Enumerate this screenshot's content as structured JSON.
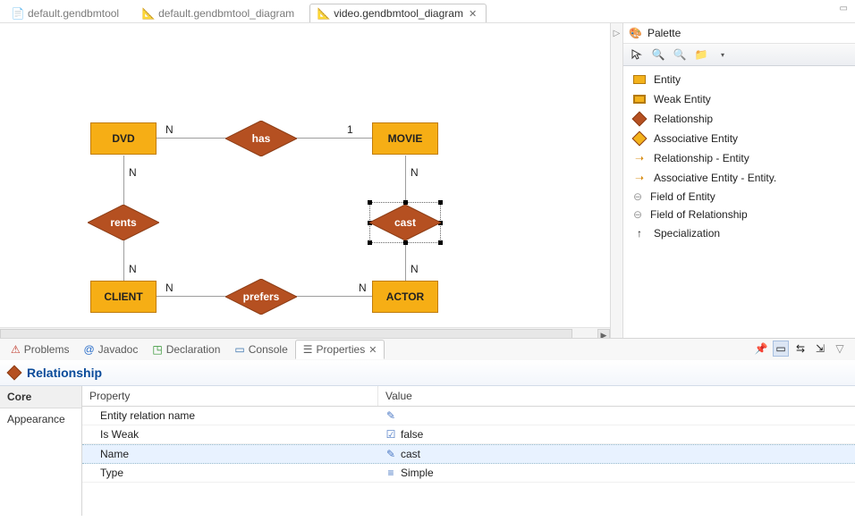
{
  "tabs": {
    "items": [
      {
        "label": "default.gendbmtool",
        "active": false
      },
      {
        "label": "default.gendbmtool_diagram",
        "active": false
      },
      {
        "label": "video.gendbmtool_diagram",
        "active": true
      }
    ]
  },
  "diagram": {
    "entities": {
      "dvd": "DVD",
      "movie": "MOVIE",
      "client": "CLIENT",
      "actor": "ACTOR"
    },
    "relationships": {
      "has": "has",
      "rents": "rents",
      "cast": "cast",
      "prefers": "prefers"
    },
    "cardinalities": {
      "dvd_has": "N",
      "has_movie": "1",
      "dvd_rents": "N",
      "rents_client": "N",
      "client_prefers": "N",
      "prefers_actor": "N",
      "movie_cast": "N",
      "cast_actor": "N"
    }
  },
  "palette": {
    "title": "Palette",
    "items": [
      {
        "label": "Entity",
        "icon": "entity"
      },
      {
        "label": "Weak Entity",
        "icon": "weak-entity"
      },
      {
        "label": "Relationship",
        "icon": "relationship"
      },
      {
        "label": "Associative Entity",
        "icon": "assoc-entity"
      },
      {
        "label": "Relationship - Entity",
        "icon": "rel-entity"
      },
      {
        "label": "Associative Entity - Entity.",
        "icon": "assoc-rel"
      },
      {
        "label": "Field of Entity",
        "icon": "field"
      },
      {
        "label": "Field of Relationship",
        "icon": "field"
      },
      {
        "label": "Specialization",
        "icon": "spec"
      }
    ]
  },
  "bottomTabs": {
    "items": [
      {
        "label": "Problems"
      },
      {
        "label": "Javadoc"
      },
      {
        "label": "Declaration"
      },
      {
        "label": "Console"
      },
      {
        "label": "Properties",
        "active": true
      }
    ]
  },
  "properties": {
    "title": "Relationship",
    "sideTabs": [
      "Core",
      "Appearance"
    ],
    "header": {
      "c1": "Property",
      "c2": "Value"
    },
    "rows": [
      {
        "name": "Entity relation name",
        "value": "",
        "selected": false
      },
      {
        "name": "Is Weak",
        "value": "false",
        "selected": false
      },
      {
        "name": "Name",
        "value": "cast",
        "selected": true
      },
      {
        "name": "Type",
        "value": "Simple",
        "selected": false
      }
    ]
  }
}
